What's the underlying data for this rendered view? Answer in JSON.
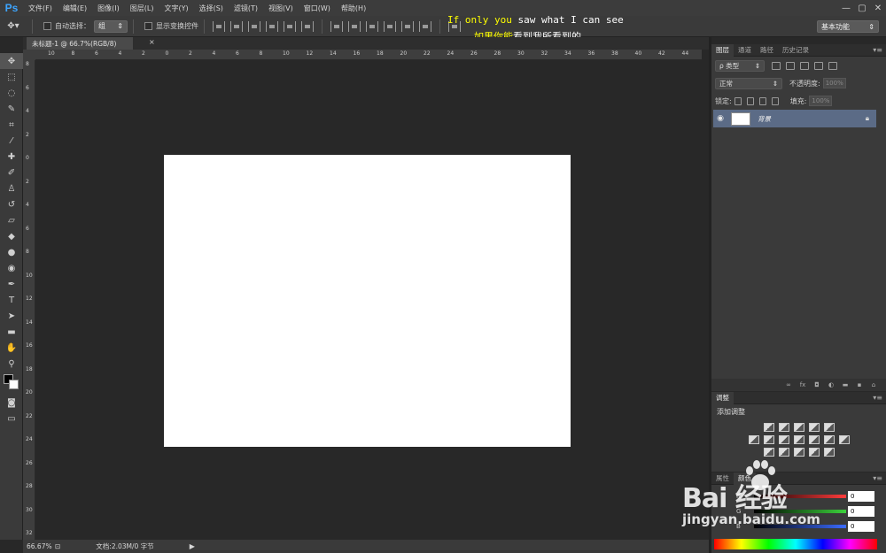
{
  "app": {
    "logo": "Ps"
  },
  "menu": [
    "文件(F)",
    "编辑(E)",
    "图像(I)",
    "图层(L)",
    "文字(Y)",
    "选择(S)",
    "滤镜(T)",
    "视图(V)",
    "窗口(W)",
    "帮助(H)"
  ],
  "subtitles": {
    "line1_yellow": "If only you",
    "line1_white": " saw what I can see",
    "line2_yellow": "如果你能",
    "line2_white": "看到我所看到的"
  },
  "options": {
    "auto_select_label": "自动选择：",
    "auto_select_value": "组",
    "show_transform_label": "显示变换控件",
    "workspace": "基本功能"
  },
  "document": {
    "tab_title": "未标题-1 @ 66.7%(RGB/8)",
    "tab_close": "×",
    "zoom": "66.67%",
    "doc_info": "文档:2.03M/0 字节",
    "status_arrow": "▶"
  },
  "ruler": {
    "top_ticks": [
      "10",
      "8",
      "6",
      "4",
      "2",
      "0",
      "2",
      "4",
      "6",
      "8",
      "10",
      "12",
      "14",
      "16",
      "18",
      "20",
      "22",
      "24",
      "26",
      "28",
      "30",
      "32",
      "34",
      "36",
      "38",
      "40",
      "42",
      "44"
    ],
    "left_ticks": [
      "8",
      "6",
      "4",
      "2",
      "0",
      "2",
      "4",
      "6",
      "8",
      "10",
      "12",
      "14",
      "16",
      "18",
      "20",
      "22",
      "24",
      "26",
      "28",
      "30",
      "32"
    ]
  },
  "layers_panel": {
    "tabs": [
      "图层",
      "通道",
      "路径",
      "历史记录"
    ],
    "filter_label": "ρ 类型",
    "blend_mode": "正常",
    "opacity_label": "不透明度:",
    "opacity_value": "100%",
    "lock_label": "锁定:",
    "fill_label": "填充:",
    "fill_value": "100%",
    "layer_name": "背景",
    "footer_icons": [
      "∞",
      "fx",
      "◘",
      "◐",
      "▬",
      "▪",
      "⌂"
    ]
  },
  "adjust_panel": {
    "tab": "调整",
    "title": "添加调整"
  },
  "color_panel": {
    "tabs": [
      "属性",
      "颜色"
    ],
    "channels": [
      {
        "label": "R",
        "value": "0",
        "color": "#ff3b3b"
      },
      {
        "label": "G",
        "value": "0",
        "color": "#3bd13b"
      },
      {
        "label": "B",
        "value": "0",
        "color": "#3b6bff"
      }
    ]
  },
  "watermark": {
    "brand": "Bai  经验",
    "url": "jingyan.baidu.com"
  },
  "colors": {
    "canvas_bg": "#282828",
    "panel_bg": "#3a3a3a",
    "selection": "#5b6b86",
    "subtitle_yellow": "#ffff00"
  }
}
